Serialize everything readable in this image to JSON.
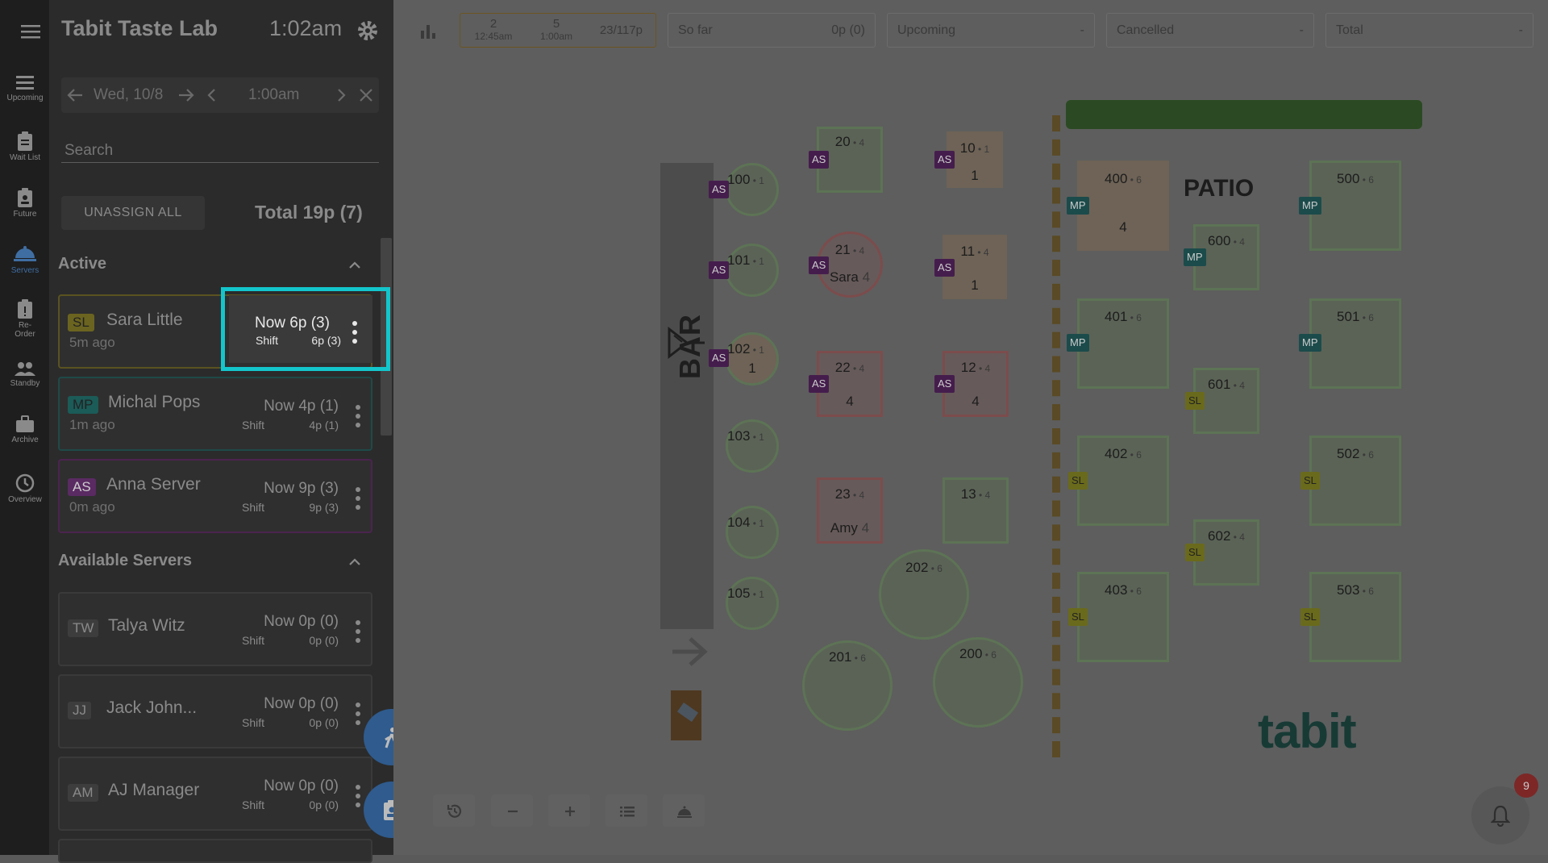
{
  "rail": [
    {
      "label": "Upcoming",
      "icon": "list-icon"
    },
    {
      "label": "Wait List",
      "icon": "clipboard-icon"
    },
    {
      "label": "Future",
      "icon": "clipboard-user-icon"
    },
    {
      "label": "Servers",
      "icon": "server-cloche-icon",
      "active": true
    },
    {
      "label": "Re-\nOrder",
      "icon": "reorder-icon"
    },
    {
      "label": "Standby",
      "icon": "people-icon"
    },
    {
      "label": "Archive",
      "icon": "briefcase-icon"
    },
    {
      "label": "Overview",
      "icon": "clock-icon"
    }
  ],
  "header": {
    "brand": "Tabit Taste Lab",
    "time": "1:02am"
  },
  "datebar": {
    "date": "Wed, 10/8",
    "time": "1:00am"
  },
  "search": {
    "placeholder": "Search"
  },
  "unassign_label": "UNASSIGN ALL",
  "total_label": "Total  19p (7)",
  "active_section": "Active",
  "available_section": "Available Servers",
  "active_servers": [
    {
      "initials": "SL",
      "name": "Sara Little",
      "ago": "5m ago",
      "now": "Now",
      "now_val": "6p (3)",
      "shift": "Shift",
      "shift_val": "6p (3)",
      "badge_color": "#e6d21e"
    },
    {
      "initials": "MP",
      "name": "Michal Pops",
      "ago": "1m ago",
      "now": "Now",
      "now_val": "4p (1)",
      "shift": "Shift",
      "shift_val": "4p (1)",
      "badge_color": "#1b8a86"
    },
    {
      "initials": "AS",
      "name": "Anna Server",
      "ago": "0m ago",
      "now": "Now",
      "now_val": "9p (3)",
      "shift": "Shift",
      "shift_val": "9p (3)",
      "badge_color": "#8e3a9a"
    }
  ],
  "available_servers": [
    {
      "initials": "TW",
      "name": "Talya Witz",
      "now": "Now",
      "now_val": "0p (0)",
      "shift": "Shift",
      "shift_val": "0p (0)"
    },
    {
      "initials": "JJ",
      "name": "Jack John...",
      "now": "Now",
      "now_val": "0p (0)",
      "shift": "Shift",
      "shift_val": "0p (0)"
    },
    {
      "initials": "AM",
      "name": "AJ Manager",
      "now": "Now",
      "now_val": "0p (0)",
      "shift": "Shift",
      "shift_val": "0p (0)"
    }
  ],
  "stats": {
    "slots": [
      {
        "n": "2",
        "t": "12:45am"
      },
      {
        "n": "5",
        "t": "1:00am"
      }
    ],
    "covers": "23/117p",
    "so_far": {
      "label": "So far",
      "value": "0p (0)"
    },
    "upcoming": {
      "label": "Upcoming",
      "value": "-"
    },
    "cancelled": {
      "label": "Cancelled",
      "value": "-"
    },
    "total": {
      "label": "Total",
      "value": "-"
    }
  },
  "floor": {
    "bar_label": "BAR",
    "patio_label": "PATIO",
    "logo": "tabit",
    "notification_count": "9",
    "tables": [
      {
        "id": "100",
        "cap": "1",
        "server": "AS"
      },
      {
        "id": "101",
        "cap": "1",
        "server": "AS"
      },
      {
        "id": "102",
        "cap": "1",
        "server": "AS",
        "guests": "1"
      },
      {
        "id": "103",
        "cap": "1"
      },
      {
        "id": "104",
        "cap": "1"
      },
      {
        "id": "105",
        "cap": "1"
      },
      {
        "id": "20",
        "cap": "4",
        "server": "AS"
      },
      {
        "id": "21",
        "cap": "4",
        "server": "AS",
        "guest_name": "Sara",
        "guests": "4"
      },
      {
        "id": "22",
        "cap": "4",
        "server": "AS",
        "guests": "4"
      },
      {
        "id": "23",
        "cap": "4",
        "guest_name": "Amy",
        "guests": "4"
      },
      {
        "id": "10",
        "cap": "1",
        "server": "AS",
        "guests": "1"
      },
      {
        "id": "11",
        "cap": "4",
        "server": "AS",
        "guests": "1"
      },
      {
        "id": "12",
        "cap": "4",
        "server": "AS",
        "guests": "4"
      },
      {
        "id": "13",
        "cap": "4"
      },
      {
        "id": "202",
        "cap": "6"
      },
      {
        "id": "201",
        "cap": "6"
      },
      {
        "id": "200",
        "cap": "6"
      },
      {
        "id": "400",
        "cap": "6",
        "server": "MP",
        "guests": "4"
      },
      {
        "id": "401",
        "cap": "6",
        "server": "MP"
      },
      {
        "id": "402",
        "cap": "6",
        "server": "SL"
      },
      {
        "id": "403",
        "cap": "6",
        "server": "SL"
      },
      {
        "id": "600",
        "cap": "4",
        "server": "MP"
      },
      {
        "id": "601",
        "cap": "4",
        "server": "SL"
      },
      {
        "id": "602",
        "cap": "4",
        "server": "SL"
      },
      {
        "id": "500",
        "cap": "6",
        "server": "MP"
      },
      {
        "id": "501",
        "cap": "6",
        "server": "MP"
      },
      {
        "id": "502",
        "cap": "6",
        "server": "SL"
      },
      {
        "id": "503",
        "cap": "6",
        "server": "SL"
      }
    ]
  }
}
